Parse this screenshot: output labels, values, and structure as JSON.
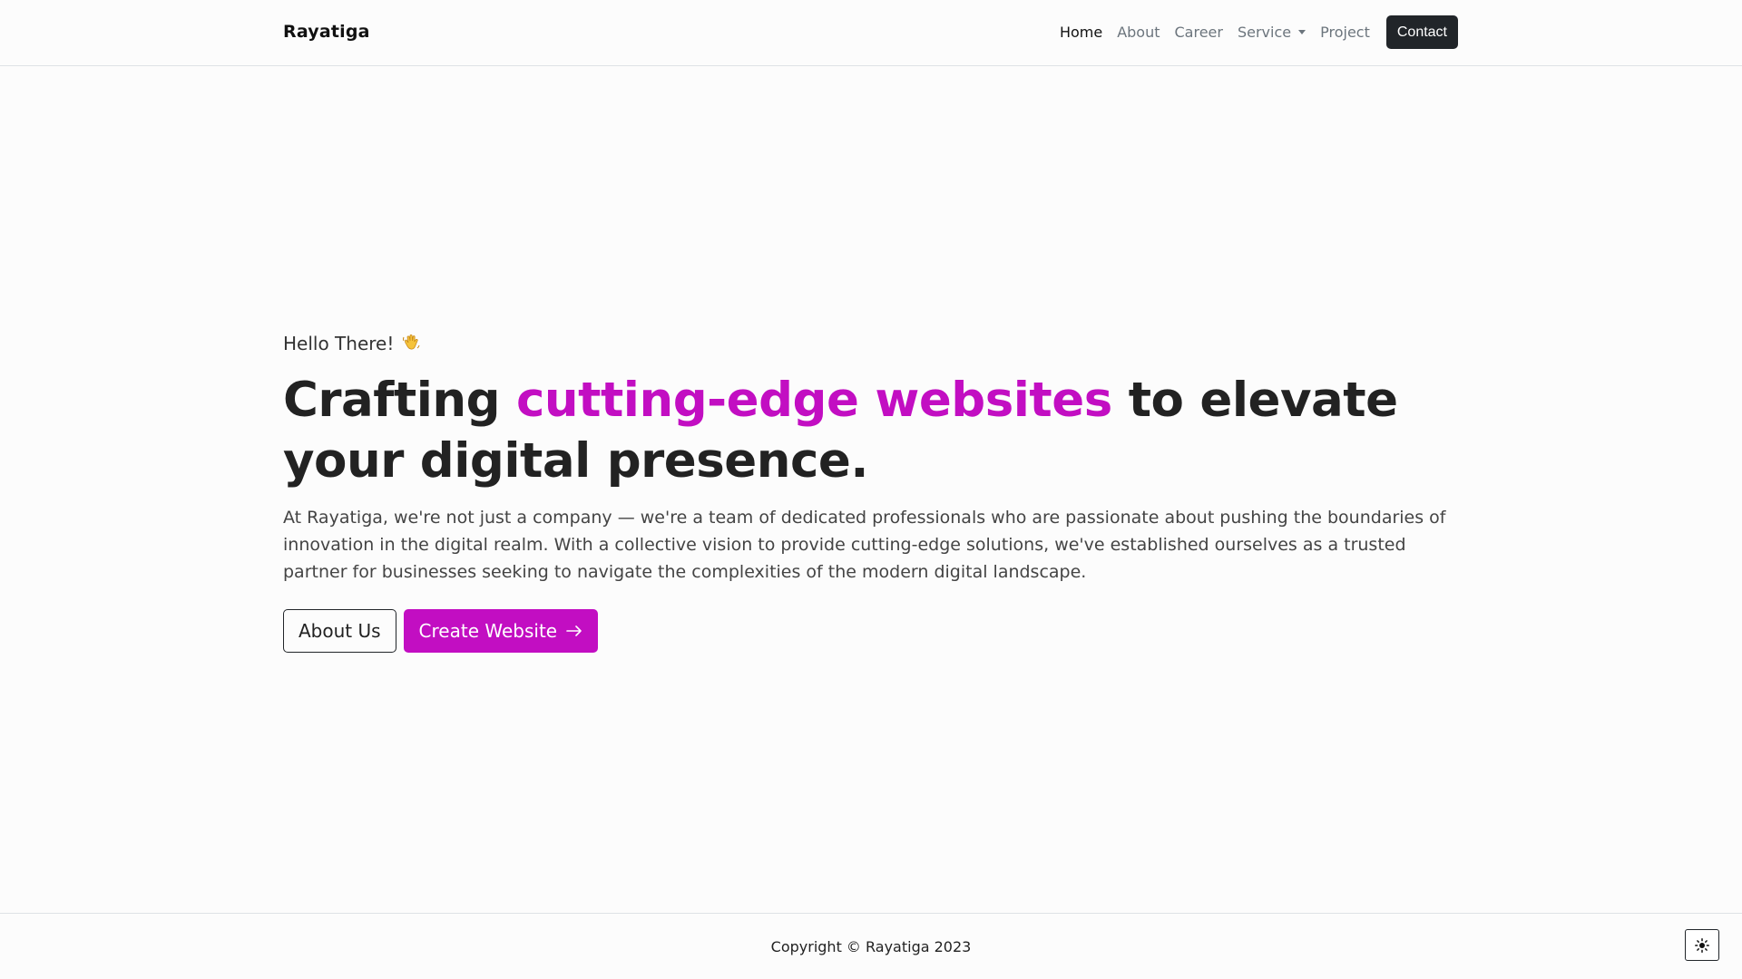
{
  "navbar": {
    "brand": "Rayatiga",
    "links": [
      {
        "label": "Home",
        "active": true
      },
      {
        "label": "About",
        "active": false
      },
      {
        "label": "Career",
        "active": false
      },
      {
        "label": "Service",
        "active": false,
        "dropdown": true
      },
      {
        "label": "Project",
        "active": false
      }
    ],
    "contact_label": "Contact"
  },
  "hero": {
    "greeting": "Hello There!",
    "greeting_icon": "waving-hand-icon",
    "headline_start": "Crafting ",
    "headline_accent": "cutting-edge websites",
    "headline_end": " to elevate your digital presence.",
    "description": "At Rayatiga, we're not just a company — we're a team of dedicated professionals who are passionate about pushing the boundaries of innovation in the digital realm. With a collective vision to provide cutting-edge solutions, we've established ourselves as a trusted partner for businesses seeking to navigate the complexities of the modern digital landscape.",
    "about_button": "About Us",
    "create_button": "Create Website",
    "create_icon": "arrow-right-icon"
  },
  "footer": {
    "copyright": "Copyright © Rayatiga 2023",
    "theme_toggle_icon": "sun-icon"
  },
  "colors": {
    "accent": "#c20ec2",
    "dark": "#212529",
    "muted": "#6c757d",
    "background": "#fcfcfc"
  }
}
